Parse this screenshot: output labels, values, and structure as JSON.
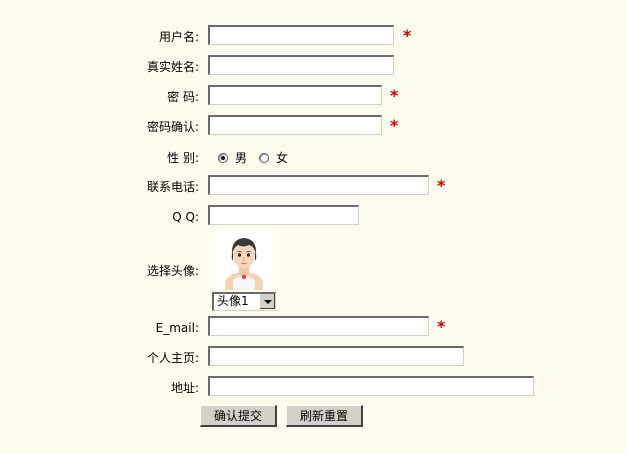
{
  "form": {
    "username": {
      "label": "用户名:",
      "value": "",
      "required_mark": "*"
    },
    "realname": {
      "label": "真实姓名:",
      "value": ""
    },
    "password": {
      "label": "密  码:",
      "value": "",
      "required_mark": "*"
    },
    "password_confirm": {
      "label": "密码确认:",
      "value": "",
      "required_mark": "*"
    },
    "gender": {
      "label": "性  别:",
      "options": [
        {
          "label": "男",
          "checked": true
        },
        {
          "label": "女",
          "checked": false
        }
      ]
    },
    "phone": {
      "label": "联系电话:",
      "value": "",
      "required_mark": "*"
    },
    "qq": {
      "label": "Q Q:",
      "value": ""
    },
    "avatar": {
      "label": "选择头像:",
      "selected": "头像1",
      "icon": "avatar-boy-icon"
    },
    "email": {
      "label": "E_mail:",
      "value": "",
      "required_mark": "*"
    },
    "homepage": {
      "label": "个人主页:",
      "value": ""
    },
    "address": {
      "label": "地址:",
      "value": ""
    },
    "submit_label": "确认提交",
    "reset_label": "刷新重置"
  },
  "colors": {
    "background": "#fefbee",
    "required": "#cc0000",
    "button": "#d4d0c8"
  }
}
